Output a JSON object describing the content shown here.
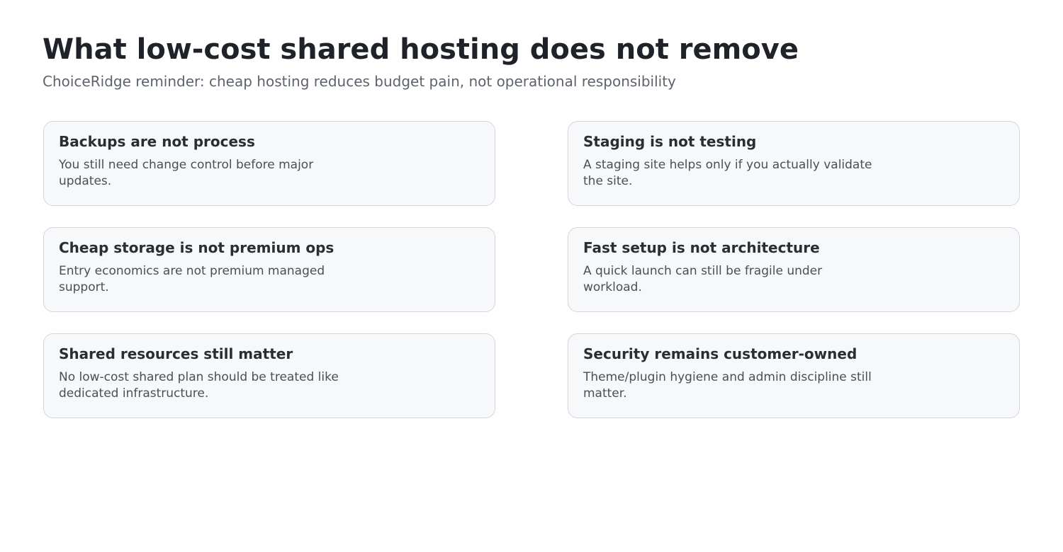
{
  "header": {
    "title": "What low-cost shared hosting does not remove",
    "subtitle": "ChoiceRidge reminder: cheap hosting reduces budget pain, not operational responsibility"
  },
  "cards": [
    {
      "title": "Backups are not process",
      "body": "You still need change control before major updates."
    },
    {
      "title": "Staging is not testing",
      "body": "A staging site helps only if you actually validate the site."
    },
    {
      "title": "Cheap storage is not premium ops",
      "body": "Entry economics are not premium managed support."
    },
    {
      "title": "Fast setup is not architecture",
      "body": "A quick launch can still be fragile under workload."
    },
    {
      "title": "Shared resources still matter",
      "body": "No low-cost shared plan should be treated like dedicated infrastructure."
    },
    {
      "title": "Security remains customer-owned",
      "body": "Theme/plugin hygiene and admin discipline still matter."
    }
  ],
  "colors": {
    "title": "#1f2329",
    "subtitle": "#5d636c",
    "card_background": "#f7f8fa",
    "card_border": "#d3d6dd"
  }
}
